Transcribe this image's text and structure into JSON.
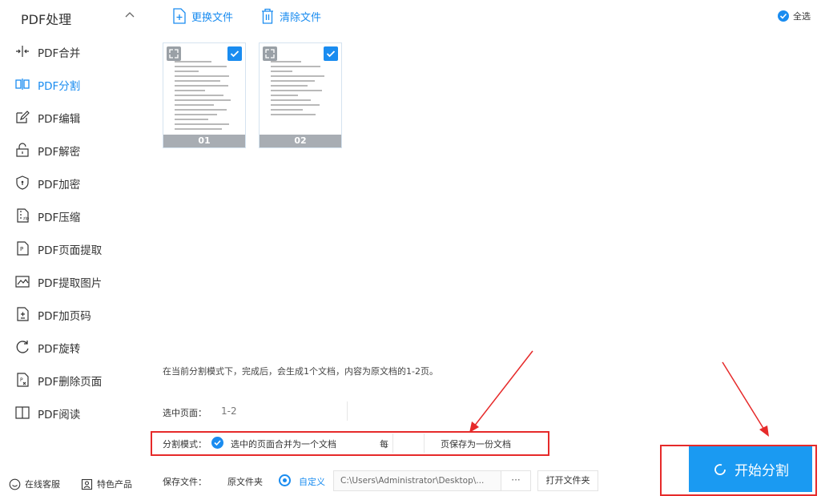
{
  "sidebar": {
    "title": "PDF处理",
    "items": [
      {
        "label": "PDF合并",
        "icon": "merge-icon"
      },
      {
        "label": "PDF分割",
        "icon": "split-icon",
        "active": true
      },
      {
        "label": "PDF编辑",
        "icon": "edit-icon"
      },
      {
        "label": "PDF解密",
        "icon": "unlock-icon"
      },
      {
        "label": "PDF加密",
        "icon": "shield-icon"
      },
      {
        "label": "PDF压缩",
        "icon": "compress-icon"
      },
      {
        "label": "PDF页面提取",
        "icon": "page-extract-icon"
      },
      {
        "label": "PDF提取图片",
        "icon": "image-extract-icon"
      },
      {
        "label": "PDF加页码",
        "icon": "page-number-icon"
      },
      {
        "label": "PDF旋转",
        "icon": "rotate-icon"
      },
      {
        "label": "PDF删除页面",
        "icon": "delete-page-icon"
      },
      {
        "label": "PDF阅读",
        "icon": "book-icon"
      }
    ],
    "footer": {
      "service_label": "在线客服",
      "products_label": "特色产品"
    }
  },
  "toolbar": {
    "replace_label": "更换文件",
    "clear_label": "清除文件",
    "select_all_label": "全选"
  },
  "thumbnails": [
    {
      "caption": "01",
      "checked": true
    },
    {
      "caption": "02",
      "checked": true
    }
  ],
  "settings": {
    "info_text": "在当前分割模式下，完成后，会生成1个文档，内容为原文档的1-2页。",
    "selected_pages_label": "选中页面：",
    "selected_pages_value": "1-2",
    "mode_label": "分割模式：",
    "mode_option": "选中的页面合并为一个文档",
    "every_label": "每",
    "every_value": "",
    "page_save_label": "页保存为一份文档",
    "save_label": "保存文件：",
    "original_folder_label": "原文件夹",
    "custom_label": "自定义",
    "save_path": "C:\\Users\\Administrator\\Desktop\\...",
    "browse_label": "···",
    "open_folder_label": "打开文件夹"
  },
  "start_button": {
    "label": "开始分割"
  },
  "colors": {
    "accent": "#1a8cf0",
    "annotation": "#e62a2a"
  }
}
